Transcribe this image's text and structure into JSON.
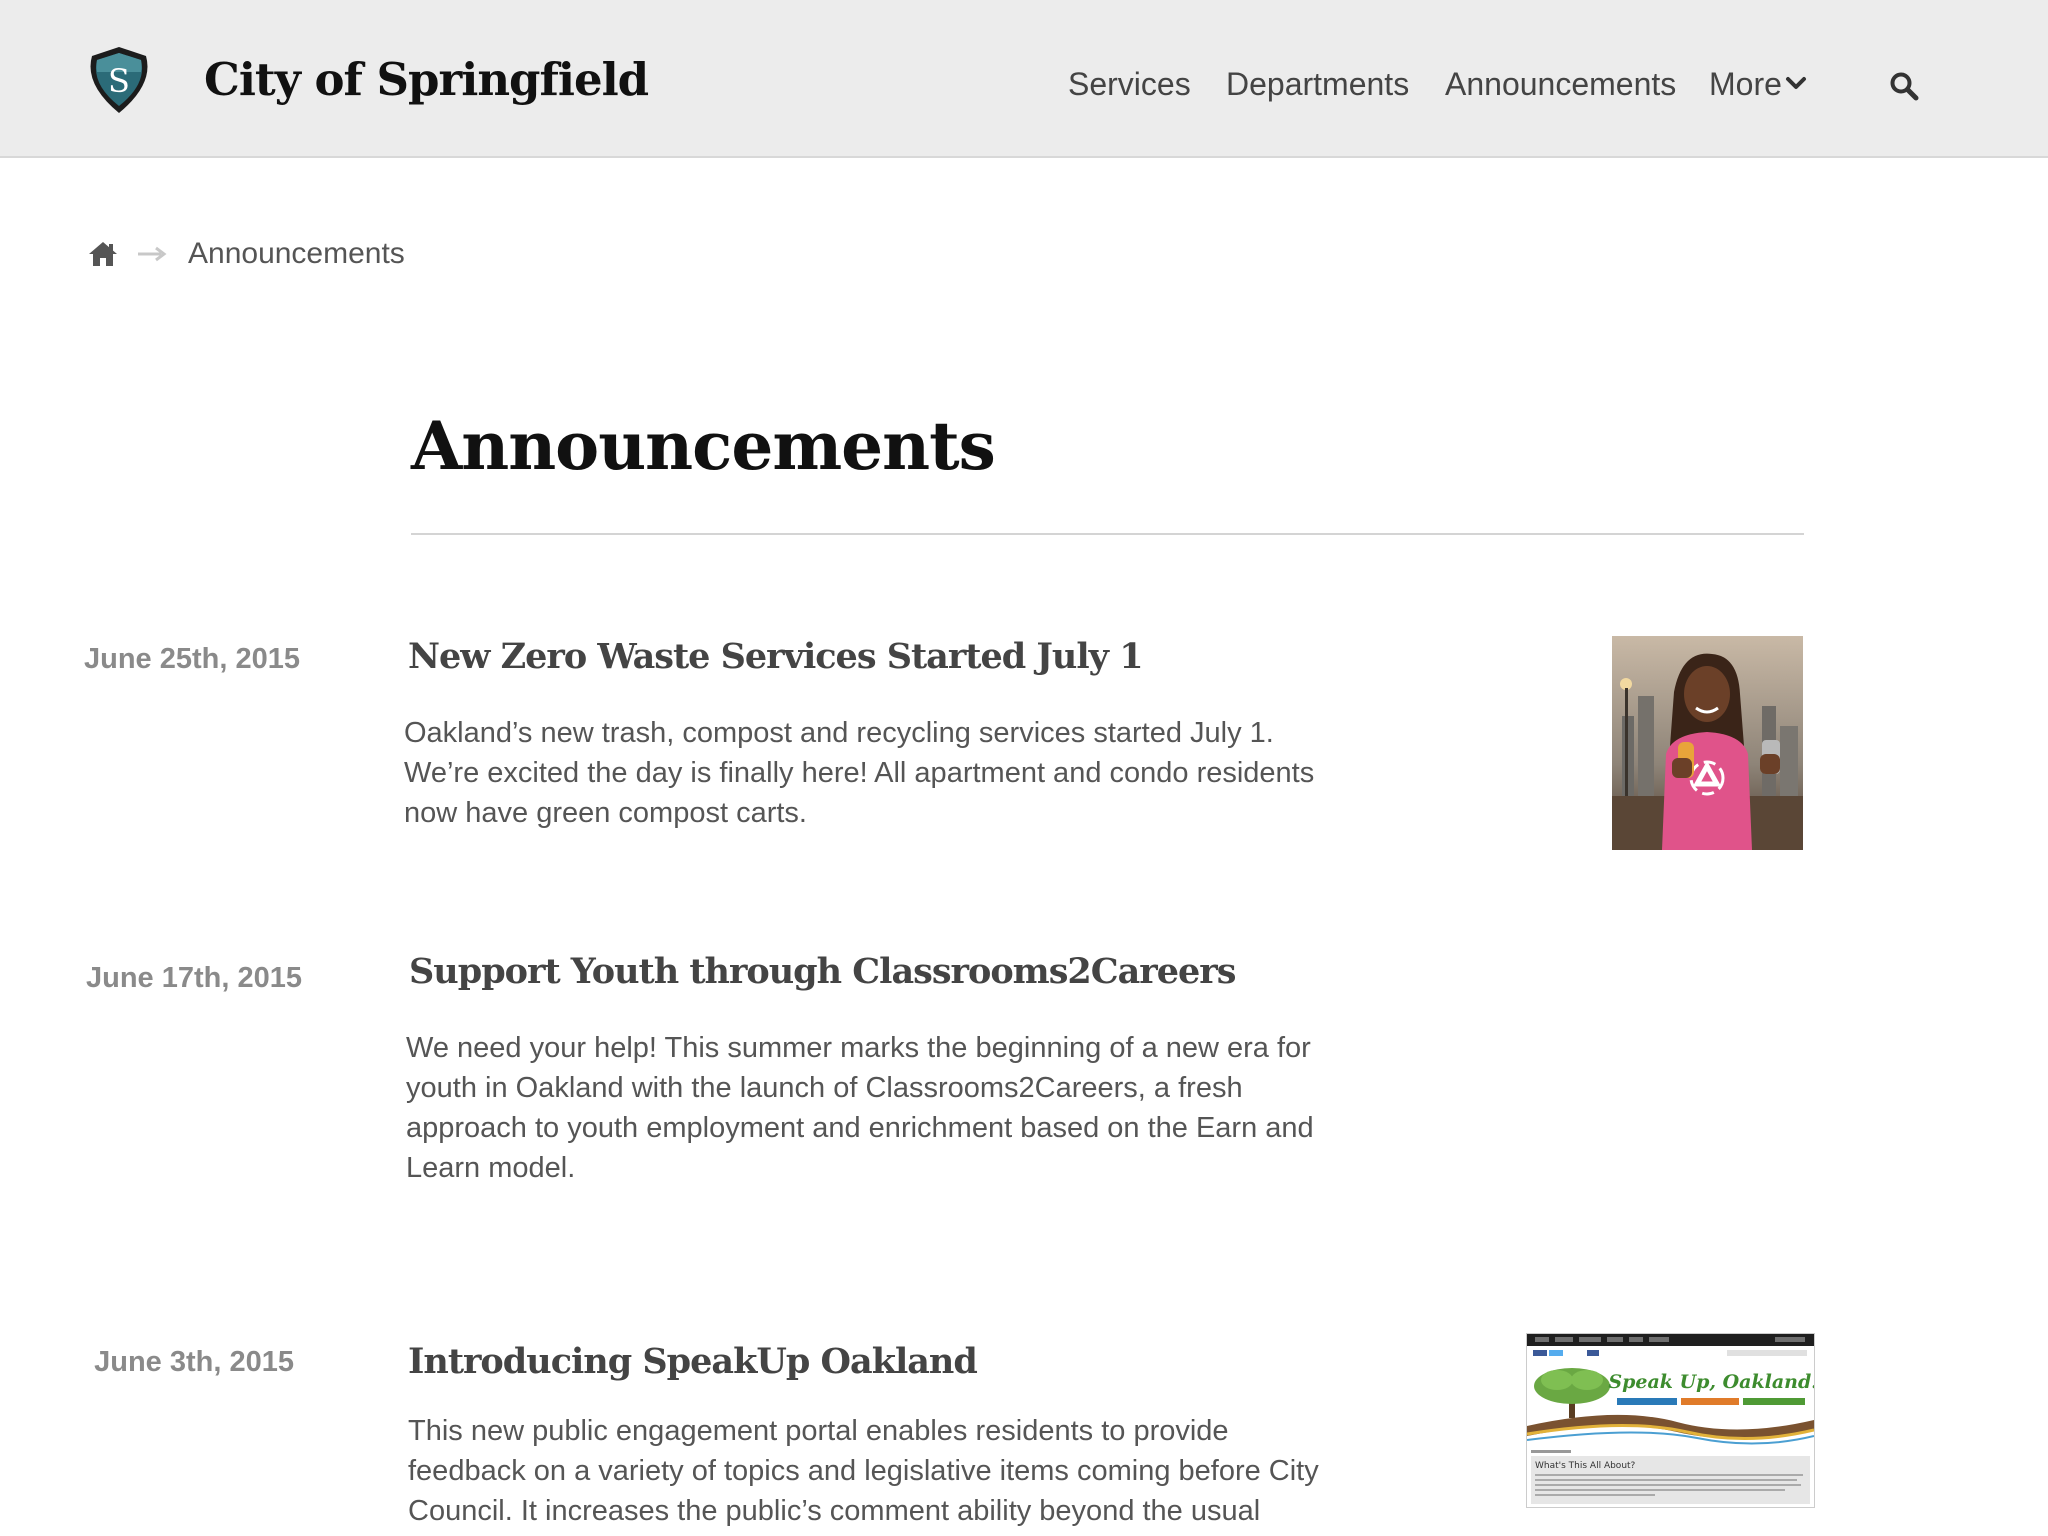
{
  "header": {
    "site_title": "City of Springfield",
    "logo_letter": "S",
    "nav": {
      "services": "Services",
      "departments": "Departments",
      "announcements": "Announcements",
      "more": "More"
    }
  },
  "breadcrumb": {
    "current": "Announcements"
  },
  "page": {
    "title": "Announcements"
  },
  "announcements": [
    {
      "date": "June 25th, 2015",
      "title": "New Zero Waste Services Started July 1",
      "body": "Oakland’s new trash, compost and recycling services started July 1. We’re excited the day is finally here! All apartment and condo residents now have green compost carts."
    },
    {
      "date": "June 17th, 2015",
      "title": "Support Youth through Classrooms2Careers",
      "body": "We need your help! This summer marks the beginning of a new era for youth in Oakland with the launch of Classrooms2Careers, a fresh approach to youth employment and enrichment based on the Earn and Learn model."
    },
    {
      "date": "June 3th, 2015",
      "title": "Introducing SpeakUp Oakland",
      "body": "This new public engagement portal enables residents to provide feedback on a variety of topics and legislative items coming before City Council. It increases the public’s comment ability beyond the usual"
    }
  ],
  "speakup_thumb": {
    "headline": "Speak Up, Oakland!",
    "section_heading": "What's This All About?"
  },
  "colors": {
    "header_bg": "#ececec",
    "logo_teal": "#2b6b78",
    "text_dark": "#111111",
    "text_body": "#555555",
    "date_gray": "#8a8a8a",
    "shirt_pink": "#e0538a"
  }
}
